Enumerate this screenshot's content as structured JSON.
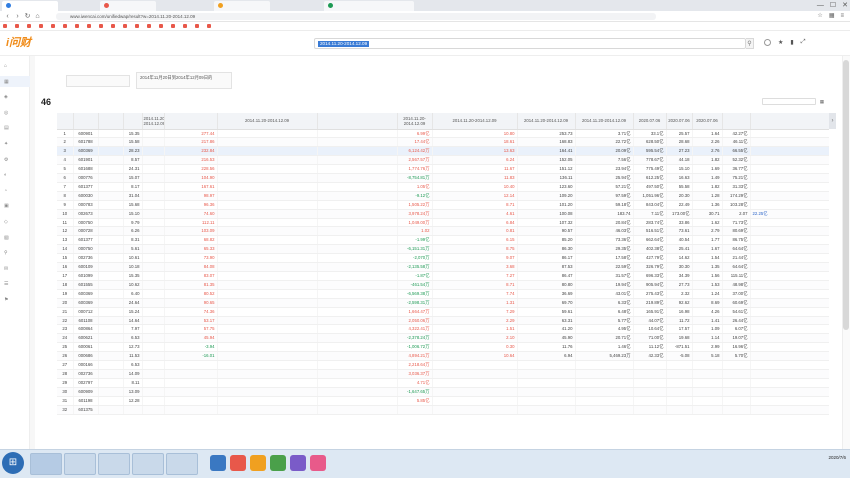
{
  "browser": {
    "tabs": [
      {
        "label": "",
        "color": "#2f7de1"
      },
      {
        "label": "",
        "color": "#e8584a"
      },
      {
        "label": "",
        "color": "#f0a020"
      },
      {
        "label": "",
        "color": "#1d9a54"
      }
    ],
    "address": "www.iwencai.com/unifiedwap/result?w=2014.11.20-2014.12.09",
    "bookmarks": [
      "",
      "",
      "",
      "",
      "",
      "",
      "",
      "",
      "",
      "",
      "",
      "",
      "",
      "",
      "",
      "",
      "",
      ""
    ]
  },
  "app": {
    "logo": "i问财",
    "search_query": "2014.11.20-2014.12.09",
    "breadcrumb": "",
    "condition1": "",
    "condition2_line1": "2014年11月20日到2014年12月09日的",
    "condition2_line2": "",
    "condition2_highlight": "",
    "result_count": "46",
    "result_prefix": "",
    "link1": "",
    "link2": "",
    "link3": "",
    "tools_label": ""
  },
  "sidebar": {
    "items": [
      {
        "icon": "⌂",
        "label": ""
      },
      {
        "icon": "▦",
        "label": ""
      },
      {
        "icon": "◈",
        "label": ""
      },
      {
        "icon": "◎",
        "label": ""
      },
      {
        "icon": "▤",
        "label": ""
      },
      {
        "icon": "✦",
        "label": ""
      },
      {
        "icon": "⚙",
        "label": ""
      },
      {
        "icon": "◐",
        "label": ""
      },
      {
        "icon": "◔",
        "label": ""
      },
      {
        "icon": "▣",
        "label": ""
      },
      {
        "icon": "◇",
        "label": ""
      },
      {
        "icon": "▧",
        "label": ""
      },
      {
        "icon": "⚲",
        "label": ""
      },
      {
        "icon": "✉",
        "label": ""
      },
      {
        "icon": "☰",
        "label": ""
      },
      {
        "icon": "⚑",
        "label": ""
      }
    ]
  },
  "table": {
    "headers": [
      "",
      "",
      "",
      "",
      "2014.11.20-2014.12.09",
      "",
      "2014.11.20-2014.12.09",
      "2014.11.20-2014.12.09",
      "2014.11.20-2014.12.09",
      "2014.11.20-2014.12.09",
      "2014.11.20-2014.12.09",
      "2020.07.06",
      "2020.07.06",
      "2020.07.06",
      ""
    ],
    "rows": [
      [
        "1",
        "600901",
        "",
        "15.35",
        "",
        "277.44",
        "",
        "",
        "6.99亿",
        "10.80",
        "253.73",
        "3.71亿",
        "33.1亿",
        "25.57",
        "1.64",
        "42.27亿",
        ""
      ],
      [
        "2",
        "601788",
        "",
        "15.58",
        "",
        "217.86",
        "",
        "",
        "17.44亿",
        "18.61",
        "168.83",
        "22.72亿",
        "628.50亿",
        "28.68",
        "2.26",
        "46.11亿",
        ""
      ],
      [
        "3",
        "600369",
        "",
        "28.23",
        "",
        "232.84",
        "",
        "",
        "6,124.42万",
        "13.63",
        "164.41",
        "20.09亿",
        "595.54亿",
        "27.23",
        "2.76",
        "66.55亿",
        ""
      ],
      [
        "4",
        "601901",
        "",
        "8.57",
        "",
        "216.53",
        "",
        "",
        "2,567.57万",
        "6.24",
        "152.05",
        "7.56亿",
        "778.67亿",
        "44.18",
        "1.82",
        "52.32亿",
        ""
      ],
      [
        "5",
        "601688",
        "",
        "24.31",
        "",
        "228.56",
        "",
        "",
        "1,774.76万",
        "11.67",
        "151.12",
        "23.94亿",
        "775.49亿",
        "15.10",
        "1.69",
        "36.77亿",
        ""
      ],
      [
        "6",
        "000776",
        "",
        "15.07",
        "",
        "104.90",
        "",
        "",
        "-8,754.81万",
        "11.83",
        "136.11",
        "25.94亿",
        "612.25亿",
        "16.63",
        "1.49",
        "75.21亿",
        ""
      ],
      [
        "7",
        "601377",
        "",
        "8.17",
        "",
        "167.61",
        "",
        "",
        "1.05亿",
        "10.40",
        "123.60",
        "57.21亿",
        "497.50亿",
        "55.58",
        "1.82",
        "31.33亿",
        ""
      ],
      [
        "8",
        "600030",
        "",
        "31.04",
        "",
        "98.97",
        "",
        "",
        "-9.12亿",
        "12.14",
        "109.20",
        "97.59亿",
        "1,051.96亿",
        "20.30",
        "1.28",
        "174.29亿",
        ""
      ],
      [
        "9",
        "000783",
        "",
        "15.68",
        "",
        "96.36",
        "",
        "",
        "1,505.22万",
        "8.71",
        "101.20",
        "59.18亿",
        "843.04亿",
        "22.49",
        "1.36",
        "103.28亿",
        ""
      ],
      [
        "10",
        "002673",
        "",
        "15.10",
        "",
        "74.60",
        "",
        "",
        "3,978.24万",
        "4.61",
        "100.08",
        "183.74",
        "7.11亿",
        "173.00亿",
        "30.71",
        "2.07",
        "22.25亿"
      ],
      [
        "11",
        "000750",
        "",
        "9.79",
        "",
        "112.11",
        "",
        "",
        "1,049.00万",
        "6.84",
        "107.32",
        "20.84亿",
        "283.74亿",
        "33.86",
        "1.62",
        "71.73亿",
        ""
      ],
      [
        "12",
        "000728",
        "",
        "6.26",
        "",
        "103.09",
        "",
        "",
        "1.02",
        "0.81",
        "90.57",
        "46.03亿",
        "516.51亿",
        "73.61",
        "2.79",
        "80.69亿",
        ""
      ],
      [
        "13",
        "601377",
        "",
        "8.31",
        "",
        "68.82",
        "",
        "",
        "-1.99亿",
        "6.15",
        "85.20",
        "73.36亿",
        "662.64亿",
        "40.54",
        "1.77",
        "86.75亿",
        ""
      ],
      [
        "14",
        "000750",
        "",
        "5.61",
        "",
        "65.33",
        "",
        "",
        "-6,151.31万",
        "8.75",
        "86.30",
        "29.35亿",
        "402.38亿",
        "25.41",
        "1.67",
        "64.64亿",
        ""
      ],
      [
        "15",
        "002736",
        "",
        "10.61",
        "",
        "73.90",
        "",
        "",
        "-2,070万",
        "9.07",
        "86.17",
        "17.58亿",
        "427.79亿",
        "14.62",
        "1.54",
        "21.44亿",
        ""
      ],
      [
        "16",
        "600109",
        "",
        "10.18",
        "",
        "84.08",
        "",
        "",
        "-2,135.58万",
        "3.68",
        "87.53",
        "22.59亿",
        "326.79亿",
        "30.30",
        "1.35",
        "64.64亿",
        ""
      ],
      [
        "17",
        "601099",
        "",
        "15.35",
        "",
        "83.07",
        "",
        "",
        "-1.87亿",
        "7.27",
        "86.47",
        "31.57亿",
        "696.33亿",
        "34.39",
        "1.56",
        "115.11亿",
        ""
      ],
      [
        "18",
        "601555",
        "",
        "10.62",
        "",
        "81.35",
        "",
        "",
        "-461.54万",
        "8.71",
        "80.80",
        "19.94亿",
        "905.94亿",
        "27.73",
        "1.53",
        "48.98亿",
        ""
      ],
      [
        "19",
        "600369",
        "",
        "6.40",
        "",
        "80.52",
        "",
        "",
        "-6,569.38万",
        "7.74",
        "36.69",
        "43.01亿",
        "275.43亿",
        "2.32",
        "1.24",
        "37.00亿",
        ""
      ],
      [
        "20",
        "600369",
        "",
        "24.64",
        "",
        "90.65",
        "",
        "",
        "-2,598.31万",
        "1.31",
        "69.70",
        "6.33亿",
        "219.89亿",
        "92.62",
        "8.69",
        "60.69亿",
        ""
      ],
      [
        "21",
        "000712",
        "",
        "15.24",
        "",
        "74.36",
        "",
        "",
        "1,664.47万",
        "7.29",
        "59.61",
        "6.48亿",
        "165.91亿",
        "16.98",
        "4.26",
        "54.61亿",
        ""
      ],
      [
        "22",
        "601108",
        "",
        "14.64",
        "",
        "53.17",
        "",
        "",
        "2,050.06万",
        "2.29",
        "63.31",
        "5.77亿",
        "44.07亿",
        "11.72",
        "1.41",
        "26.44亿",
        ""
      ],
      [
        "23",
        "600864",
        "",
        "7.97",
        "",
        "57.75",
        "",
        "",
        "4,322.41万",
        "1.51",
        "41.20",
        "4.95亿",
        "10.64亿",
        "17.57",
        "1.09",
        "6.07亿",
        ""
      ],
      [
        "24",
        "600621",
        "",
        "6.53",
        "",
        "45.94",
        "",
        "",
        "-2,378.24万",
        "2.10",
        "45.90",
        "20.71亿",
        "71.00亿",
        "19.68",
        "1.14",
        "19.07亿",
        ""
      ],
      [
        "25",
        "600061",
        "",
        "12.73",
        "",
        "-3.94",
        "",
        "",
        "-1,006.72万",
        "0.30",
        "11.76",
        "1.46亿",
        "11.12亿",
        "-871.51",
        "2.99",
        "16.96亿",
        ""
      ],
      [
        "26",
        "000686",
        "",
        "11.53",
        "",
        "-16.01",
        "",
        "",
        "4,894.21万",
        "10.64",
        "6.94",
        "5,469.23万",
        "42.33亿",
        "-5.08",
        "5.18",
        "5.70亿",
        ""
      ],
      [
        "27",
        "000166",
        "",
        "6.53",
        "",
        "",
        "",
        "",
        "2,218.64万",
        "",
        "",
        "",
        "",
        "",
        "",
        "",
        ""
      ],
      [
        "28",
        "002736",
        "",
        "14.09",
        "",
        "",
        "",
        "",
        "3,036.37万",
        "",
        "",
        "",
        "",
        "",
        "",
        "",
        ""
      ],
      [
        "29",
        "002797",
        "",
        "8.11",
        "",
        "",
        "",
        "",
        "4.71亿",
        "",
        "",
        "",
        "",
        "",
        "",
        "",
        ""
      ],
      [
        "30",
        "600909",
        "",
        "13.09",
        "",
        "",
        "",
        "",
        "-1,647.65万",
        "",
        "",
        "",
        "",
        "",
        "",
        "",
        ""
      ],
      [
        "31",
        "601198",
        "",
        "12.28",
        "",
        "",
        "",
        "",
        "5.85亿",
        "",
        "",
        "",
        "",
        "",
        "",
        "",
        ""
      ],
      [
        "32",
        "601375",
        "",
        "",
        "",
        "",
        "",
        "",
        "",
        "",
        "",
        "",
        "",
        "",
        "",
        "",
        ""
      ]
    ]
  },
  "taskbar": {
    "items": [
      "",
      "",
      "",
      "",
      ""
    ],
    "time": "",
    "date": "2020/7/6"
  }
}
